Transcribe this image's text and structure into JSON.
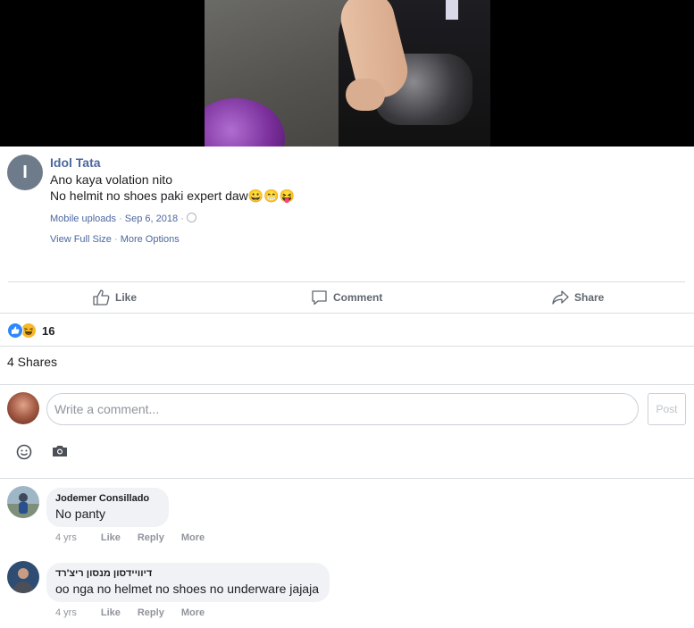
{
  "post": {
    "author": "Idol Tata",
    "avatar_initial": "I",
    "text_line1": "Ano kaya volation nito",
    "text_line2": "No helmit no shoes paki expert daw",
    "emojis": [
      "😀",
      "😁",
      "😝"
    ],
    "album": "Mobile uploads",
    "date": "Sep 6, 2018",
    "separator": "·",
    "view_full_size": "View Full Size",
    "more_options": "More Options"
  },
  "actions": {
    "like": "Like",
    "comment": "Comment",
    "share": "Share"
  },
  "reactions": {
    "count": "16",
    "types": [
      "like-reaction-icon",
      "haha-reaction-icon"
    ]
  },
  "shares": "4 Shares",
  "composer": {
    "placeholder": "Write a comment...",
    "post_label": "Post",
    "icons": [
      "smiley-icon",
      "camera-icon"
    ]
  },
  "comments": [
    {
      "name": "Jodemer Consillado",
      "text": "No panty",
      "time": "4 yrs",
      "like": "Like",
      "reply": "Reply",
      "more": "More"
    },
    {
      "name": "דיוויידסון מנסון ריצ'רד",
      "text": "oo nga no helmet no shoes no underware jajaja",
      "time": "4 yrs",
      "like": "Like",
      "reply": "Reply",
      "more": "More"
    }
  ],
  "colors": {
    "link": "#4b67a1",
    "muted": "#90949c",
    "divider": "#dadde1",
    "bubble": "#f0f2f5"
  }
}
